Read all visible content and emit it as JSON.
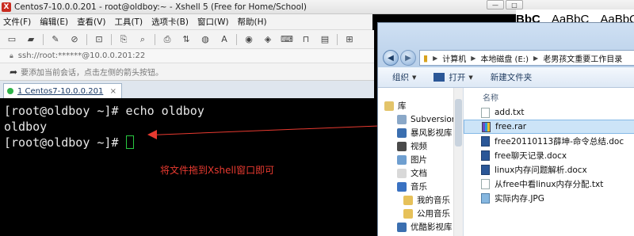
{
  "xshell": {
    "title": "Centos7-10.0.0.201 - root@oldboy:~ - Xshell 5 (Free for Home/School)",
    "menu": [
      "文件(F)",
      "编辑(E)",
      "查看(V)",
      "工具(T)",
      "选项卡(B)",
      "窗口(W)",
      "帮助(H)"
    ],
    "address": "ssh://root:******@10.0.0.201:22",
    "hint": "要添加当前会话，点击左侧的箭头按钮。",
    "tab_label": "1 Centos7-10.0.0.201",
    "terminal_lines": [
      "[root@oldboy ~]# echo oldboy",
      "oldboy",
      "[root@oldboy ~]# "
    ],
    "annotation": "将文件拖到Xshell窗口即可"
  },
  "word_styles": [
    "BbC",
    "AaBbC",
    "AaBbC"
  ],
  "explorer": {
    "breadcrumb": [
      "计算机",
      "本地磁盘 (E:)",
      "老男孩文重要工作目录"
    ],
    "commands": [
      "组织",
      "打开",
      "新建文件夹"
    ],
    "nav_items": [
      "库",
      "Subversion",
      "暴风影视库",
      "视频",
      "图片",
      "文档",
      "音乐",
      "我的音乐",
      "公用音乐",
      "优酷影视库"
    ],
    "column_header": "名称",
    "files": [
      {
        "name": "add.txt",
        "type": "txt"
      },
      {
        "name": "free.rar",
        "type": "rar",
        "selected": true
      },
      {
        "name": "free20110113薛坤-命令总结.doc",
        "type": "doc"
      },
      {
        "name": "free聊天记录.docx",
        "type": "doc"
      },
      {
        "name": "linux内存问题解析.docx",
        "type": "doc"
      },
      {
        "name": "从free中看linux内存分配.txt",
        "type": "txt"
      },
      {
        "name": "实际内存.JPG",
        "type": "jpg"
      }
    ]
  },
  "colors": {
    "annotation": "#e83a30",
    "cursor": "#28c840",
    "selection": "#cce4f7"
  }
}
